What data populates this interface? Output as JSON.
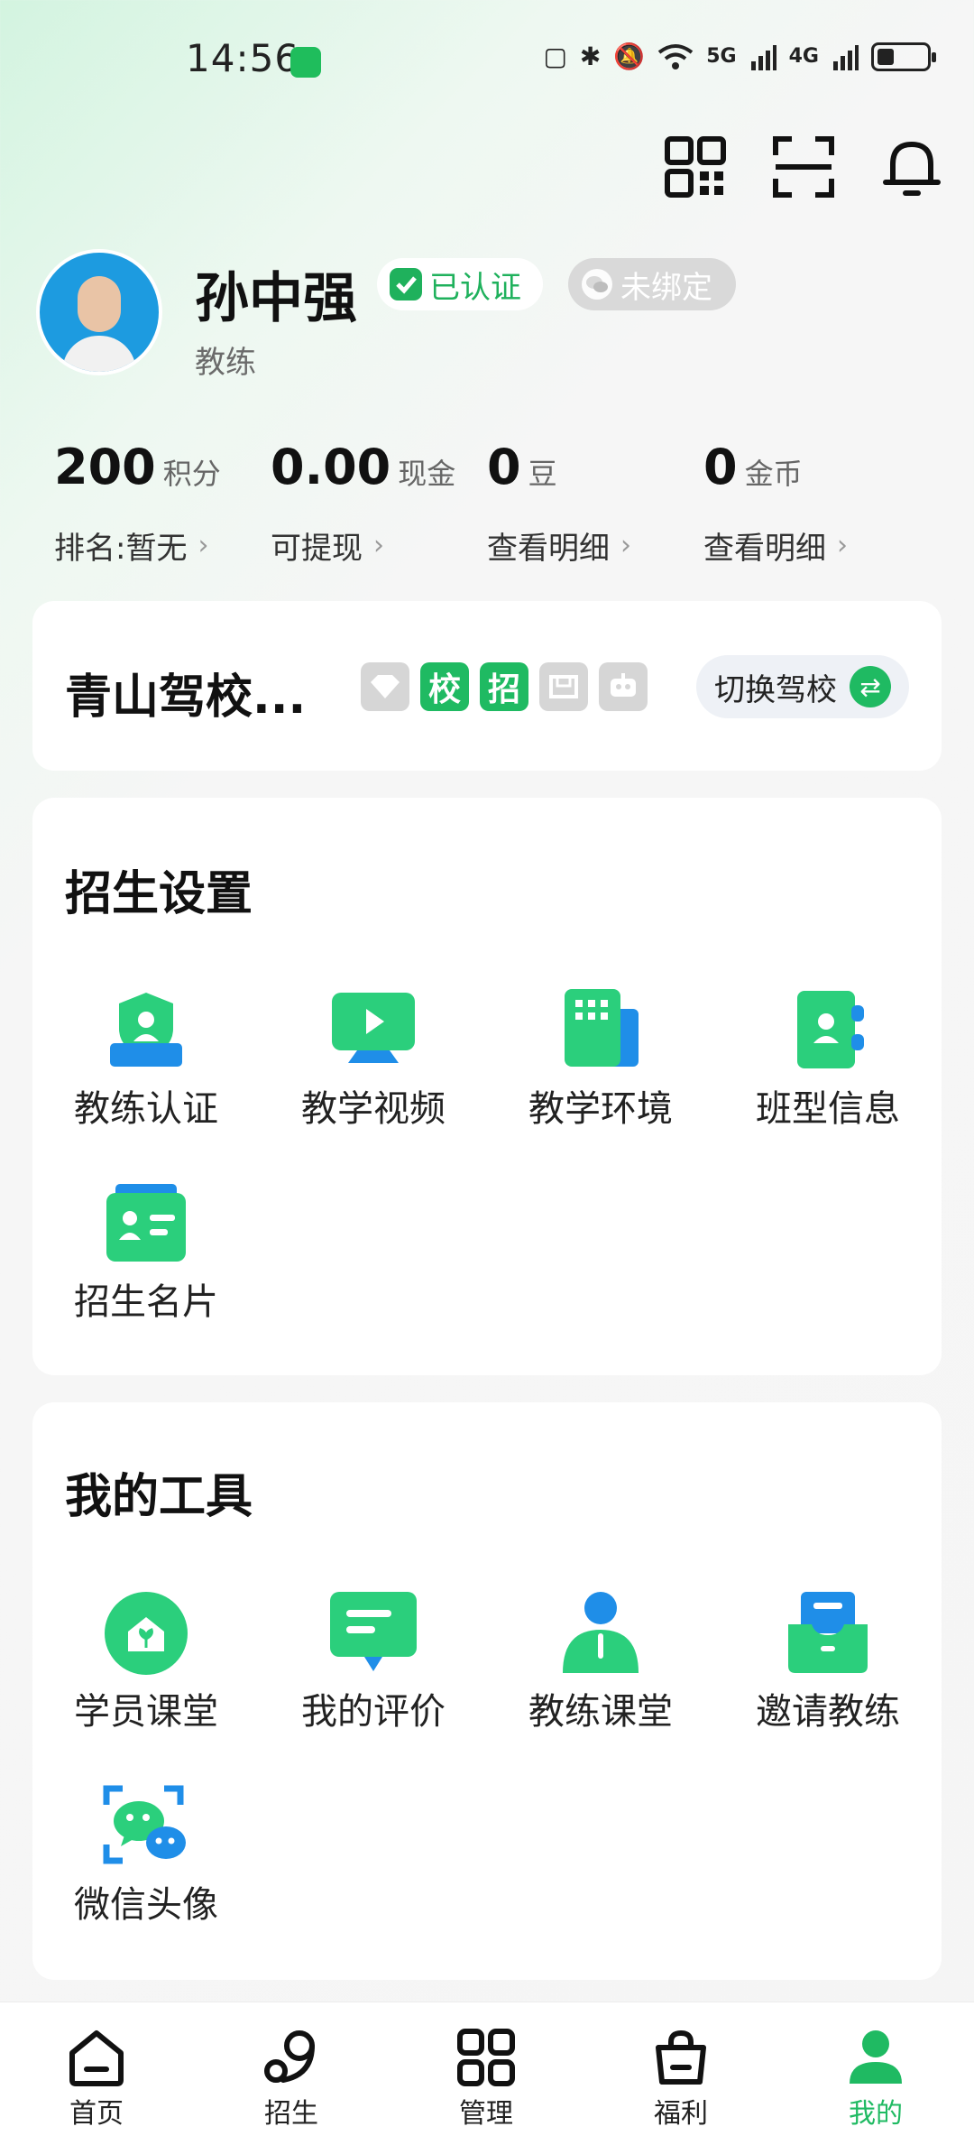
{
  "status_bar": {
    "time": "14:56",
    "net1": "5G",
    "net2": "4G",
    "battery_pct": 30
  },
  "profile": {
    "name": "孙中强",
    "verified_label": "已认证",
    "unbound_label": "未绑定",
    "role": "教练"
  },
  "stats": [
    {
      "value": "200",
      "unit": "积分",
      "link": "排名:暂无"
    },
    {
      "value": "0.00",
      "unit": "现金",
      "link": "可提现"
    },
    {
      "value": "0",
      "unit": "豆",
      "link": "查看明细"
    },
    {
      "value": "0",
      "unit": "金币",
      "link": "查看明细"
    }
  ],
  "school": {
    "name": "青山驾校...",
    "tags": [
      "校",
      "招"
    ],
    "switch_label": "切换驾校"
  },
  "enrollment": {
    "title": "招生设置",
    "items": [
      {
        "label": "教练认证",
        "icon": "coach-certify-icon"
      },
      {
        "label": "教学视频",
        "icon": "teaching-video-icon"
      },
      {
        "label": "教学环境",
        "icon": "teaching-environment-icon"
      },
      {
        "label": "班型信息",
        "icon": "class-type-icon"
      },
      {
        "label": "招生名片",
        "icon": "enrollment-card-icon"
      }
    ]
  },
  "tools": {
    "title": "我的工具",
    "items": [
      {
        "label": "学员课堂",
        "icon": "student-class-icon"
      },
      {
        "label": "我的评价",
        "icon": "my-review-icon"
      },
      {
        "label": "教练课堂",
        "icon": "coach-class-icon"
      },
      {
        "label": "邀请教练",
        "icon": "invite-coach-icon"
      },
      {
        "label": "微信头像",
        "icon": "wechat-avatar-icon"
      }
    ]
  },
  "nav": [
    {
      "label": "首页",
      "icon": "home-icon"
    },
    {
      "label": "招生",
      "icon": "enroll-icon"
    },
    {
      "label": "管理",
      "icon": "manage-icon"
    },
    {
      "label": "福利",
      "icon": "welfare-icon"
    },
    {
      "label": "我的",
      "icon": "profile-icon",
      "active": true
    }
  ],
  "colors": {
    "accent": "#1fba62",
    "background": "#f5f5f5",
    "tag_gray": "#d6d6d6"
  }
}
